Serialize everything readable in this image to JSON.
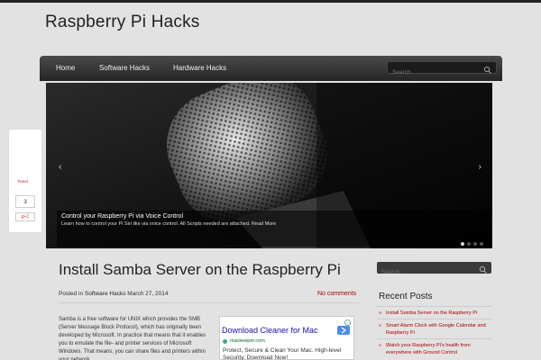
{
  "site": {
    "title": "Raspberry Pi Hacks"
  },
  "nav": {
    "items": [
      {
        "label": "Home"
      },
      {
        "label": "Software Hacks"
      },
      {
        "label": "Hardware Hacks"
      }
    ],
    "search_placeholder": "Search"
  },
  "slider": {
    "caption_title": "Control your Raspberry Pi via Voice Control",
    "caption_text": "Learn how to control your Pi Siri like via voice control. All Scripts needed are attached. Read More",
    "prev_icon": "chevron-left-icon",
    "next_icon": "chevron-right-icon",
    "slide_count": 4,
    "active_slide": 1
  },
  "share": {
    "tweet_label": "Tweet",
    "count": "3",
    "gplus_label": "g+1"
  },
  "post": {
    "title": "Install Samba Server on the Raspberry Pi",
    "meta_prefix": "Posted in",
    "category": "Software Hacks",
    "date": "March 27, 2014",
    "comments": "No comments",
    "body": "Samba is a free software for UNIX which provides the SMB (Server Message Block Protocol), which has originally been developed by Microsoft. In practice that means that it enables you to emulate the file- and printer services of Microsoft Windows. That means, you can share files and printers within your network."
  },
  "ad": {
    "title": "Download Cleaner for Mac",
    "domain": "mackeeper.com",
    "text": "Protect, Secure & Clean Your Mac. High-level Security. Download Now!",
    "info_label": "i"
  },
  "sidebar": {
    "search_placeholder": "Search",
    "heading": "Recent Posts",
    "posts": [
      {
        "label": "Install Samba Server on the Raspberry Pi"
      },
      {
        "label": "Smart Alarm Clock with Google Calendar and Raspberry Pi"
      },
      {
        "label": "Watch your Raspberry Pi's health from everywhere with Ground Control"
      }
    ]
  },
  "colors": {
    "accent": "#aa0000",
    "navbar": "#2e2e2e",
    "background": "#e2e2e2"
  }
}
